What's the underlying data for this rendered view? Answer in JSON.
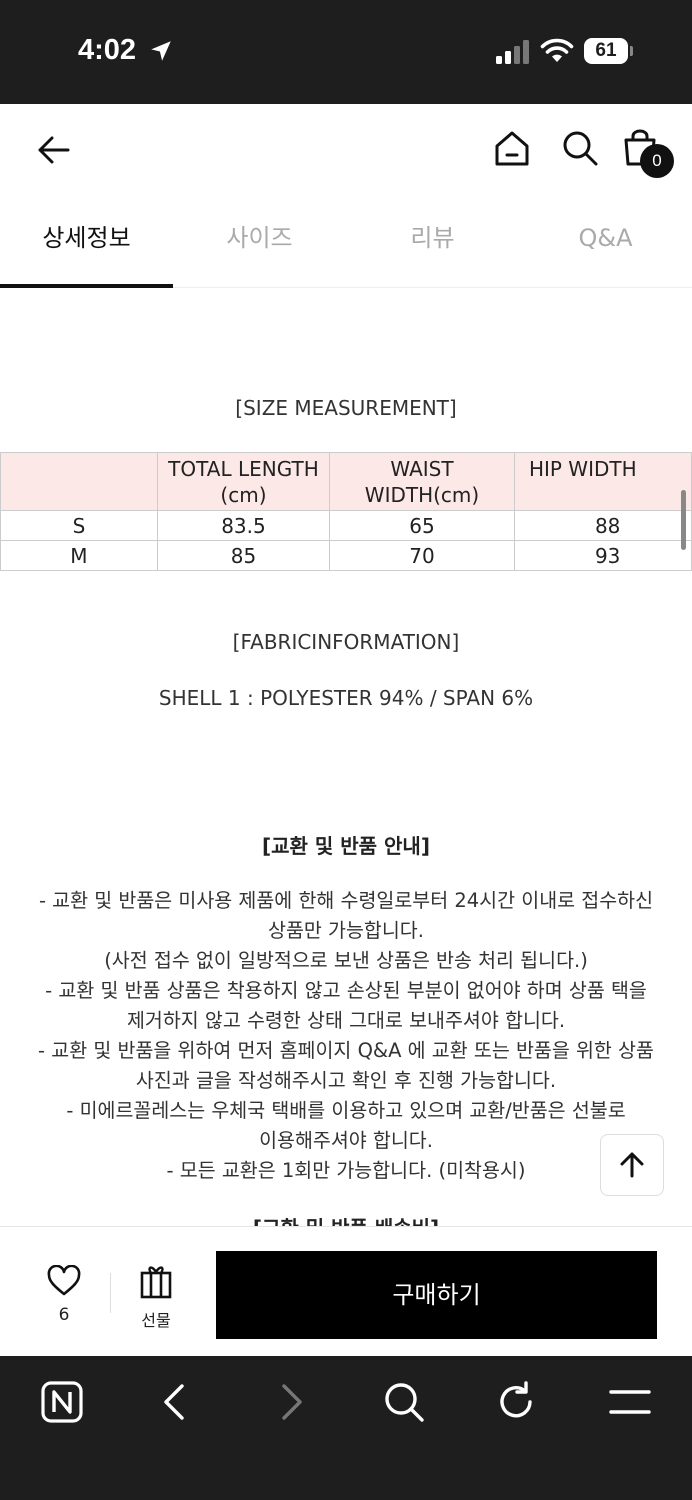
{
  "status_bar": {
    "time": "4:02",
    "battery": "61"
  },
  "header": {
    "cart_count": "0"
  },
  "tabs": [
    {
      "label": "상세정보",
      "active": true
    },
    {
      "label": "사이즈",
      "active": false
    },
    {
      "label": "리뷰",
      "active": false
    },
    {
      "label": "Q&A",
      "active": false
    }
  ],
  "size_section": {
    "title": "[SIZE MEASUREMENT]",
    "columns": [
      "",
      "TOTAL LENGTH (cm)",
      "WAIST WIDTH(cm)",
      "HIP WIDTH"
    ],
    "rows": [
      {
        "size": "S",
        "total_length": "83.5",
        "waist": "65",
        "hip": "88"
      },
      {
        "size": "M",
        "total_length": "85",
        "waist": "70",
        "hip": "93"
      }
    ]
  },
  "fabric_section": {
    "title": "[FABRICINFORMATION]",
    "text": "SHELL 1 : POLYESTER 94% / SPAN 6%"
  },
  "notice": {
    "title": "[교환 및 반품 안내]",
    "lines": [
      "- 교환 및 반품은 미사용 제품에 한해 수령일로부터 24시간 이내로 접수하신",
      "상품만 가능합니다.",
      "(사전 접수 없이 일방적으로 보낸 상품은 반송 처리 됩니다.)",
      "- 교환 및 반품 상품은 착용하지 않고 손상된 부분이 없어야 하며 상품 택을",
      "제거하지 않고 수령한 상태 그대로 보내주셔야 합니다.",
      "- 교환 및 반품을 위하여 먼저 홈페이지 Q&A 에 교환 또는 반품을 위한 상품",
      "사진과 글을 작성해주시고 확인 후 진행 가능합니다.",
      "- 미에르꼴레스는 우체국 택배를 이용하고 있으며 교환/반품은 선불로",
      "이용해주셔야 합니다.",
      "- 모든 교환은 1회만 가능합니다. (미착용시)"
    ],
    "next_title_partial": "[교환 및 반품 배송비]"
  },
  "buy_bar": {
    "like_count": "6",
    "gift_label": "선물",
    "purchase_label": "구매하기"
  },
  "icons": {
    "back": "back-arrow-icon",
    "home": "home-icon",
    "search": "search-icon",
    "cart": "shopping-bag-icon",
    "heart": "heart-icon",
    "gift": "gift-icon",
    "scroll_top": "arrow-up-icon",
    "browser_home": "naver-n-icon",
    "browser_back": "chevron-left-icon",
    "browser_forward": "chevron-right-icon",
    "browser_search": "search-icon",
    "browser_reload": "reload-icon",
    "browser_menu": "menu-icon"
  }
}
